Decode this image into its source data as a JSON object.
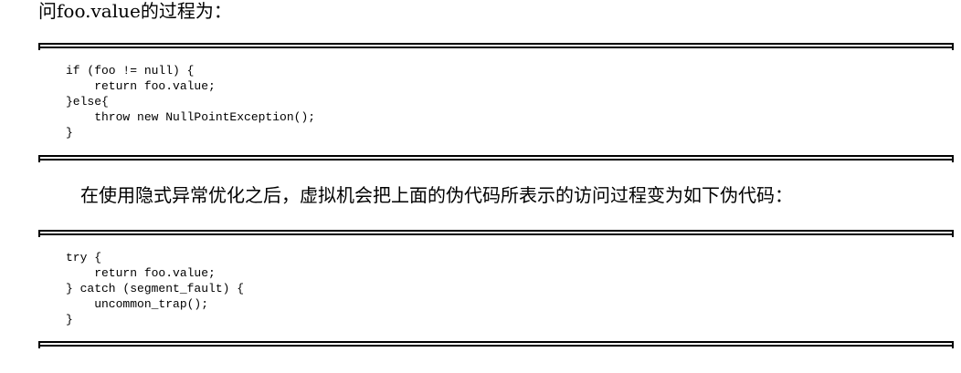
{
  "paragraphs": {
    "intro": "问foo.value的过程为：",
    "middle": "在使用隐式异常优化之后，虚拟机会把上面的伪代码所表示的访问过程变为如下伪代码："
  },
  "code_blocks": [
    {
      "lines": [
        "if (foo != null) {",
        "    return foo.value;",
        "}else{",
        "    throw new NullPointException();",
        "}"
      ]
    },
    {
      "lines": [
        "try {",
        "    return foo.value;",
        "} catch (segment_fault) {",
        "    uncommon_trap();",
        "}"
      ]
    }
  ]
}
